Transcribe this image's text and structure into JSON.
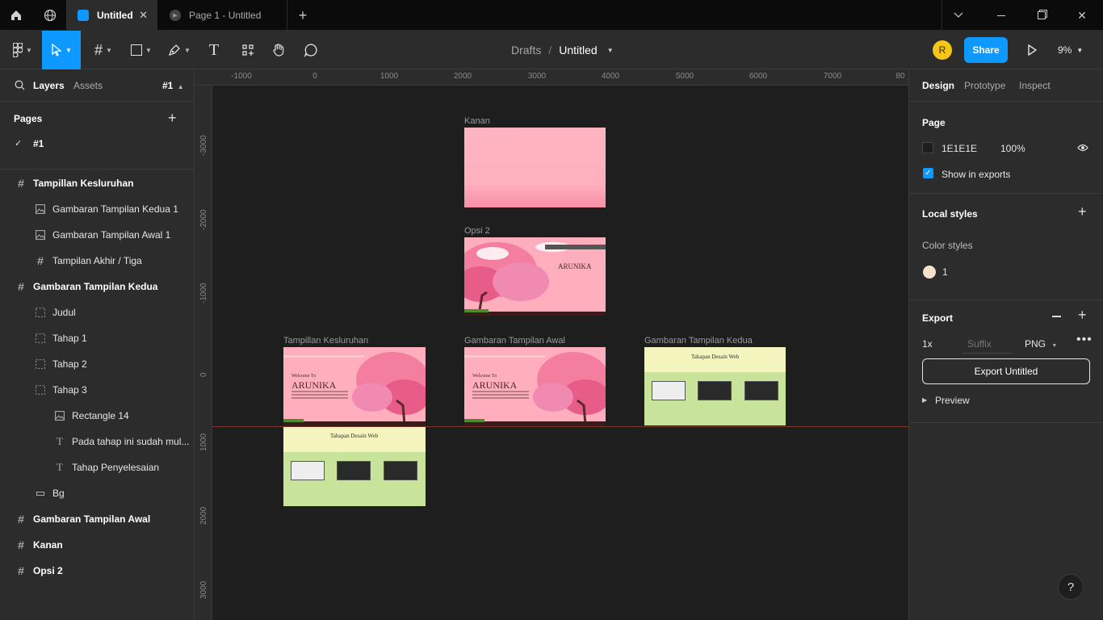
{
  "tabs": {
    "active": "Untitled",
    "second": "Page 1 - Untitled"
  },
  "toolbar": {
    "breadcrumb_parent": "Drafts",
    "breadcrumb_sep": "/",
    "file_name": "Untitled",
    "avatar_initial": "R",
    "share_label": "Share",
    "zoom": "9%"
  },
  "left": {
    "tab_layers": "Layers",
    "tab_assets": "Assets",
    "page_indicator": "#1",
    "pages_title": "Pages",
    "pages": [
      "#1"
    ],
    "layers": [
      {
        "label": "Tampillan Kesluruhan",
        "icon": "frame-icon",
        "indent": 0,
        "bold": true
      },
      {
        "label": "Gambaran Tampilan Kedua 1",
        "icon": "image-icon",
        "indent": 1,
        "bold": false
      },
      {
        "label": "Gambaran Tampilan Awal 1",
        "icon": "image-icon",
        "indent": 1,
        "bold": false
      },
      {
        "label": "Tampilan Akhir / Tiga",
        "icon": "frame-icon",
        "indent": 1,
        "bold": false
      },
      {
        "label": "Gambaran Tampilan Kedua",
        "icon": "frame-icon",
        "indent": 0,
        "bold": true
      },
      {
        "label": "Judul",
        "icon": "group-icon",
        "indent": 1,
        "bold": false
      },
      {
        "label": "Tahap 1",
        "icon": "group-icon",
        "indent": 1,
        "bold": false
      },
      {
        "label": "Tahap 2",
        "icon": "group-icon",
        "indent": 1,
        "bold": false
      },
      {
        "label": "Tahap 3",
        "icon": "group-icon",
        "indent": 1,
        "bold": false
      },
      {
        "label": "Rectangle 14",
        "icon": "image-icon",
        "indent": 2,
        "bold": false
      },
      {
        "label": "Pada tahap ini sudah mul...",
        "icon": "text-icon",
        "indent": 2,
        "bold": false
      },
      {
        "label": "Tahap Penyelesaian",
        "icon": "text-icon",
        "indent": 2,
        "bold": false
      },
      {
        "label": "Bg",
        "icon": "rectangle-icon",
        "indent": 1,
        "bold": false
      },
      {
        "label": "Gambaran Tampilan Awal",
        "icon": "frame-icon",
        "indent": 0,
        "bold": true
      },
      {
        "label": "Kanan",
        "icon": "frame-icon",
        "indent": 0,
        "bold": true
      },
      {
        "label": "Opsi 2",
        "icon": "frame-icon",
        "indent": 0,
        "bold": true
      }
    ]
  },
  "right": {
    "tab_design": "Design",
    "tab_prototype": "Prototype",
    "tab_inspect": "Inspect",
    "page_title": "Page",
    "page_color": "1E1E1E",
    "page_opacity": "100%",
    "show_in_exports": "Show in exports",
    "local_styles": "Local styles",
    "color_styles": "Color styles",
    "color_style_name": "1",
    "export_title": "Export",
    "export_scale": "1x",
    "export_suffix_placeholder": "Suffix",
    "export_format": "PNG",
    "export_button": "Export Untitled",
    "preview": "Preview",
    "help": "?"
  },
  "ruler": {
    "x_ticks": [
      "-1000",
      "0",
      "1000",
      "2000",
      "3000",
      "4000",
      "5000",
      "6000",
      "7000",
      "80"
    ],
    "y_ticks": [
      "-3000",
      "-2000",
      "-1000",
      "0",
      "1000",
      "2000",
      "3000"
    ]
  },
  "canvas": {
    "frames": {
      "kanan": "Kanan",
      "opsi2": "Opsi 2",
      "keseluruhan": "Tampillan Kesluruhan",
      "awal": "Gambaran Tampilan Awal",
      "kedua": "Gambaran Tampilan Kedua"
    },
    "welcome_to": "Welcome To",
    "arunika": "ARUNIKA",
    "web_title": "Tahapan Desain Web"
  },
  "colors": {
    "accent": "#0d99ff",
    "avatar": "#f5c518",
    "frame_pink": "#ffb4c1",
    "frame_green": "#c8e39a",
    "frame_cream": "#f4f4be",
    "color_style_swatch": "#f6e1cc"
  }
}
